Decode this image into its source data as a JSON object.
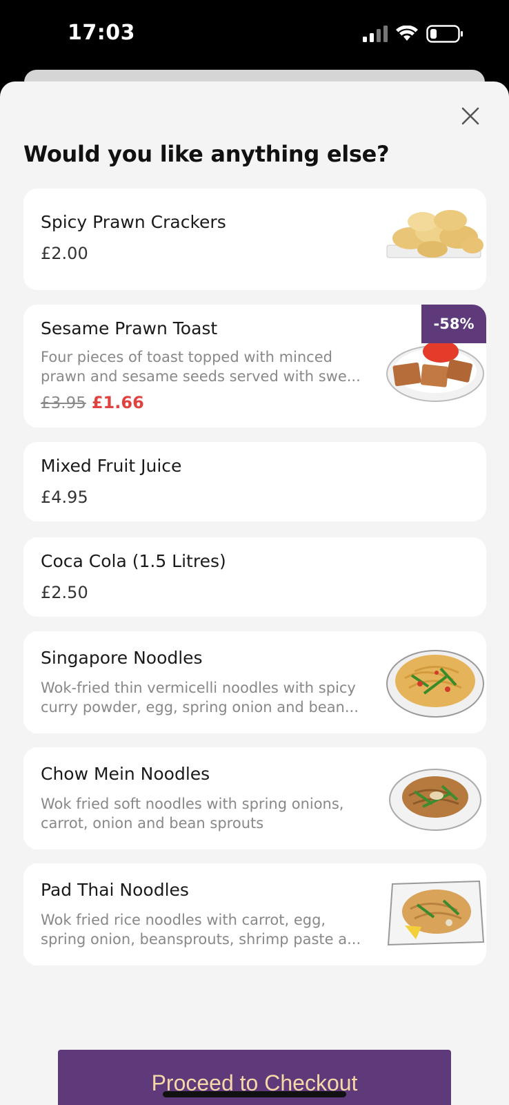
{
  "status_bar": {
    "time": "17:03"
  },
  "sheet": {
    "title": "Would you like anything else?"
  },
  "items": [
    {
      "name": "Spicy Prawn Crackers",
      "price": "£2.00"
    },
    {
      "name": "Sesame Prawn Toast",
      "desc_line1": "Four pieces of toast topped with minced",
      "desc_line2": "prawn and sesame seeds served with swe...",
      "old_price": "£3.95",
      "new_price": "£1.66",
      "badge": "-58%"
    },
    {
      "name": "Mixed Fruit Juice",
      "price": "£4.95"
    },
    {
      "name": "Coca Cola (1.5 Litres)",
      "price": "£2.50"
    },
    {
      "name": "Singapore Noodles",
      "desc_line1": "Wok-fried thin vermicelli noodles with spicy",
      "desc_line2": "curry powder, egg, spring onion and bean..."
    },
    {
      "name": "Chow Mein Noodles",
      "desc_line1": "Wok fried soft noodles with spring onions,",
      "desc_line2": "carrot, onion and bean sprouts"
    },
    {
      "name": "Pad Thai Noodles",
      "desc_line1": "Wok fried rice noodles with carrot, egg,",
      "desc_line2": "spring onion, beansprouts, shrimp paste a..."
    }
  ],
  "checkout": {
    "label": "Proceed to Checkout"
  },
  "colors": {
    "accent": "#5e3a7b",
    "button_text": "#f6d7a7",
    "sale_price": "#e0423f"
  }
}
